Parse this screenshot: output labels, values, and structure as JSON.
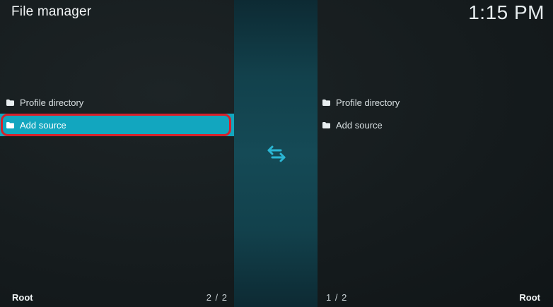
{
  "header": {
    "title": "File manager",
    "clock": "1:15 PM"
  },
  "left_pane": {
    "items": [
      {
        "label": "Profile directory",
        "icon": "folder-icon"
      },
      {
        "label": "Add source",
        "icon": "folder-icon",
        "selected": true
      }
    ],
    "footer_label": "Root",
    "page_count": "2 / 2"
  },
  "right_pane": {
    "items": [
      {
        "label": "Profile directory",
        "icon": "folder-icon"
      },
      {
        "label": "Add source",
        "icon": "folder-icon"
      }
    ],
    "footer_label": "Root",
    "page_count": "1 / 2"
  },
  "divider": {
    "icon": "swap-arrows-icon"
  },
  "colors": {
    "accent": "#12a6bf",
    "highlight_outline": "#d8202a",
    "divider": "#154a56",
    "swap_icon": "#2bb6d4"
  }
}
